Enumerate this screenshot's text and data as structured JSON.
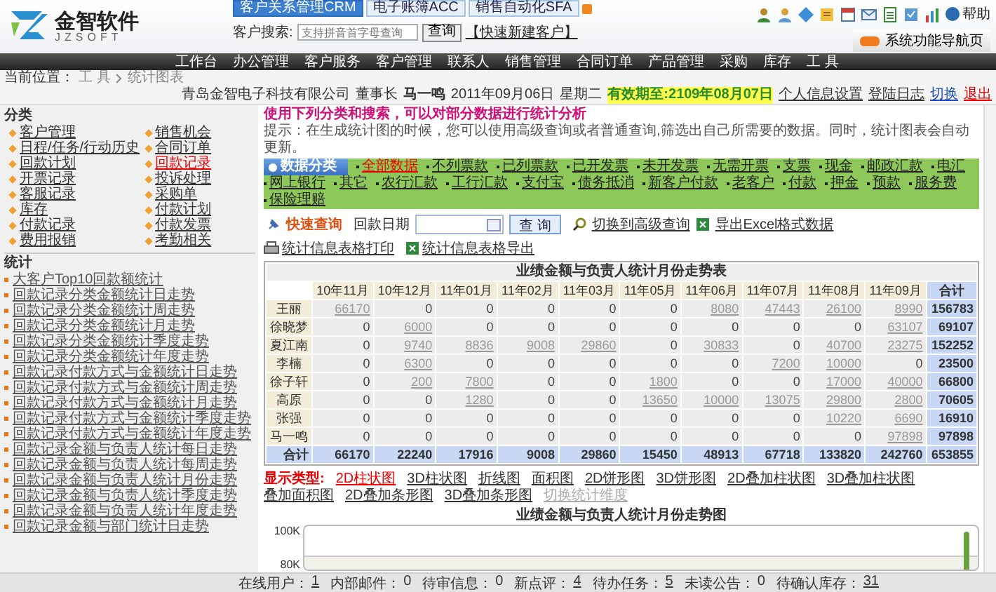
{
  "header": {
    "logo": {
      "name": "金智软件",
      "sub": "JZSOFT"
    },
    "product_tabs": [
      {
        "label": "客户关系管理CRM",
        "selected": true
      },
      {
        "label": "电子账簿ACC",
        "selected": false
      },
      {
        "label": "销售自动化SFA",
        "selected": false
      }
    ],
    "search": {
      "label": "客户搜索:",
      "placeholder": "支持拼音首字母查询",
      "button": "查询",
      "quick_link": "【快速新建客户】"
    },
    "help": "帮助",
    "nav_page_button": "系统功能导航页"
  },
  "nav": [
    "工作台",
    "办公管理",
    "客户服务",
    "客户管理",
    "联系人",
    "销售管理",
    "合同订单",
    "产品管理",
    "采购",
    "库存",
    "工 具"
  ],
  "info_bar": {
    "location_label": "当前位置：",
    "breadcrumb": [
      "工 具",
      "统计图表"
    ],
    "company": "青岛金智电子科技有限公司",
    "role": "董事长",
    "user": "马一鸣",
    "date": "2011年09月06日",
    "weekday": "星期二",
    "validity": "有效期至:2109年08月07日",
    "links": [
      {
        "label": "个人信息设置",
        "kind": "plain"
      },
      {
        "label": "登陆日志",
        "kind": "plain"
      },
      {
        "label": "切换",
        "kind": "switch"
      },
      {
        "label": "退出",
        "kind": "exit"
      }
    ]
  },
  "sidebar": {
    "category_title": "分类",
    "categories": [
      {
        "label": "客户管理",
        "selected": false
      },
      {
        "label": "销售机会",
        "selected": false
      },
      {
        "label": "日程/任务/行动历史",
        "selected": false
      },
      {
        "label": "合同订单",
        "selected": false
      },
      {
        "label": "回款计划",
        "selected": false
      },
      {
        "label": "回款记录",
        "selected": true
      },
      {
        "label": "开票记录",
        "selected": false
      },
      {
        "label": "投诉处理",
        "selected": false
      },
      {
        "label": "客服记录",
        "selected": false
      },
      {
        "label": "采购单",
        "selected": false
      },
      {
        "label": "库存",
        "selected": false
      },
      {
        "label": "付款计划",
        "selected": false
      },
      {
        "label": "付款记录",
        "selected": false
      },
      {
        "label": "付款发票",
        "selected": false
      },
      {
        "label": "费用报销",
        "selected": false
      },
      {
        "label": "考勤相关",
        "selected": false
      }
    ],
    "stats_title": "统计",
    "stats": [
      "大客户Top10回款额统计",
      "回款记录分类金额统计日走势",
      "回款记录分类金额统计周走势",
      "回款记录分类金额统计月走势",
      "回款记录分类金额统计季度走势",
      "回款记录分类金额统计年度走势",
      "回款记录付款方式与金额统计日走势",
      "回款记录付款方式与金额统计周走势",
      "回款记录付款方式与金额统计月走势",
      "回款记录付款方式与金额统计季度走势",
      "回款记录付款方式与金额统计年度走势",
      "回款记录金额与负责人统计每日走势",
      "回款记录金额与负责人统计每周走势",
      "回款记录金额与负责人统计月份走势",
      "回款记录金额与负责人统计季度走势",
      "回款记录金额与负责人统计年度走势",
      "回款记录金额与部门统计日走势"
    ]
  },
  "main": {
    "heading": "使用下列分类和搜索，可以对部分数据进行统计分析",
    "tip": "提示：在生成统计图的时候，您可以使用高级查询或者普通查询,筛选出自己所需要的数据。同时，统计图表会自动更新。",
    "category_bar": {
      "title": "数据分类",
      "items": [
        {
          "label": "全部数据",
          "selected": true
        },
        {
          "label": "不列票款",
          "selected": false
        },
        {
          "label": "已列票款",
          "selected": false
        },
        {
          "label": "已开发票",
          "selected": false
        },
        {
          "label": "未开发票",
          "selected": false
        },
        {
          "label": "无需开票",
          "selected": false
        },
        {
          "label": "支票",
          "selected": false
        },
        {
          "label": "现金",
          "selected": false
        },
        {
          "label": "邮政汇款",
          "selected": false
        },
        {
          "label": "电汇",
          "selected": false
        },
        {
          "label": "网上银行",
          "selected": false
        },
        {
          "label": "其它",
          "selected": false
        },
        {
          "label": "农行汇款",
          "selected": false
        },
        {
          "label": "工行汇款",
          "selected": false
        },
        {
          "label": "支付宝",
          "selected": false
        },
        {
          "label": "债务抵消",
          "selected": false
        },
        {
          "label": "新客户付款",
          "selected": false
        },
        {
          "label": "老客户",
          "selected": false
        },
        {
          "label": "付款",
          "selected": false
        },
        {
          "label": "押金",
          "selected": false
        },
        {
          "label": "预款",
          "selected": false
        },
        {
          "label": "服务费",
          "selected": false
        },
        {
          "label": "保险理赔",
          "selected": false
        }
      ]
    },
    "quick_search": {
      "title": "快速查询",
      "field_label": "回款日期",
      "button": "查 询",
      "advanced_link": "切换到高级查询",
      "export_link": "导出Excel格式数据"
    },
    "table_actions": [
      {
        "label": "统计信息表格打印",
        "kind": "print"
      },
      {
        "label": "统计信息表格导出",
        "kind": "export"
      }
    ],
    "table": {
      "title": "业绩金额与负责人统计月份走势表",
      "columns": [
        "10年11月",
        "10年12月",
        "11年01月",
        "11年02月",
        "11年03月",
        "11年05月",
        "11年06月",
        "11年07月",
        "11年08月",
        "11年09月"
      ],
      "total_header": "合计",
      "rows": [
        {
          "name": "王丽",
          "total": "156783",
          "cells": [
            {
              "v": "66170",
              "link": true
            },
            {
              "v": "0",
              "link": false
            },
            {
              "v": "0",
              "link": false
            },
            {
              "v": "0",
              "link": false
            },
            {
              "v": "0",
              "link": false
            },
            {
              "v": "0",
              "link": false
            },
            {
              "v": "8080",
              "link": true
            },
            {
              "v": "47443",
              "link": true
            },
            {
              "v": "26100",
              "link": true
            },
            {
              "v": "8990",
              "link": true
            }
          ]
        },
        {
          "name": "徐晓梦",
          "total": "69107",
          "cells": [
            {
              "v": "0",
              "link": false
            },
            {
              "v": "6000",
              "link": true
            },
            {
              "v": "0",
              "link": false
            },
            {
              "v": "0",
              "link": false
            },
            {
              "v": "0",
              "link": false
            },
            {
              "v": "0",
              "link": false
            },
            {
              "v": "0",
              "link": false
            },
            {
              "v": "0",
              "link": false
            },
            {
              "v": "0",
              "link": false
            },
            {
              "v": "63107",
              "link": true
            }
          ]
        },
        {
          "name": "夏江南",
          "total": "152252",
          "cells": [
            {
              "v": "0",
              "link": false
            },
            {
              "v": "9740",
              "link": true
            },
            {
              "v": "8836",
              "link": true
            },
            {
              "v": "9008",
              "link": true
            },
            {
              "v": "29860",
              "link": true
            },
            {
              "v": "0",
              "link": false
            },
            {
              "v": "30833",
              "link": true
            },
            {
              "v": "0",
              "link": false
            },
            {
              "v": "40700",
              "link": true
            },
            {
              "v": "23275",
              "link": true
            }
          ]
        },
        {
          "name": "李楠",
          "total": "23500",
          "cells": [
            {
              "v": "0",
              "link": false
            },
            {
              "v": "6300",
              "link": true
            },
            {
              "v": "0",
              "link": false
            },
            {
              "v": "0",
              "link": false
            },
            {
              "v": "0",
              "link": false
            },
            {
              "v": "0",
              "link": false
            },
            {
              "v": "0",
              "link": false
            },
            {
              "v": "7200",
              "link": true
            },
            {
              "v": "10000",
              "link": true
            },
            {
              "v": "0",
              "link": false
            }
          ]
        },
        {
          "name": "徐子轩",
          "total": "66800",
          "cells": [
            {
              "v": "0",
              "link": false
            },
            {
              "v": "200",
              "link": true
            },
            {
              "v": "7800",
              "link": true
            },
            {
              "v": "0",
              "link": false
            },
            {
              "v": "0",
              "link": false
            },
            {
              "v": "1800",
              "link": true
            },
            {
              "v": "0",
              "link": false
            },
            {
              "v": "0",
              "link": false
            },
            {
              "v": "17000",
              "link": true
            },
            {
              "v": "40000",
              "link": true
            }
          ]
        },
        {
          "name": "高原",
          "total": "70605",
          "cells": [
            {
              "v": "0",
              "link": false
            },
            {
              "v": "0",
              "link": false
            },
            {
              "v": "1280",
              "link": true
            },
            {
              "v": "0",
              "link": false
            },
            {
              "v": "0",
              "link": false
            },
            {
              "v": "13650",
              "link": true
            },
            {
              "v": "10000",
              "link": true
            },
            {
              "v": "13075",
              "link": true
            },
            {
              "v": "29800",
              "link": true
            },
            {
              "v": "2800",
              "link": true
            }
          ]
        },
        {
          "name": "张强",
          "total": "16910",
          "cells": [
            {
              "v": "0",
              "link": false
            },
            {
              "v": "0",
              "link": false
            },
            {
              "v": "0",
              "link": false
            },
            {
              "v": "0",
              "link": false
            },
            {
              "v": "0",
              "link": false
            },
            {
              "v": "0",
              "link": false
            },
            {
              "v": "0",
              "link": false
            },
            {
              "v": "0",
              "link": false
            },
            {
              "v": "10220",
              "link": true
            },
            {
              "v": "6690",
              "link": true
            }
          ]
        },
        {
          "name": "马一鸣",
          "total": "97898",
          "cells": [
            {
              "v": "0",
              "link": false
            },
            {
              "v": "0",
              "link": false
            },
            {
              "v": "0",
              "link": false
            },
            {
              "v": "0",
              "link": false
            },
            {
              "v": "0",
              "link": false
            },
            {
              "v": "0",
              "link": false
            },
            {
              "v": "0",
              "link": false
            },
            {
              "v": "0",
              "link": false
            },
            {
              "v": "0",
              "link": false
            },
            {
              "v": "97898",
              "link": true
            }
          ]
        }
      ],
      "totals": {
        "name": "合计",
        "total": "653855",
        "cells": [
          "66170",
          "22240",
          "17916",
          "9008",
          "29860",
          "15450",
          "48913",
          "67718",
          "133820",
          "242760"
        ]
      }
    },
    "chart_types": {
      "label": "显示类型:",
      "items": [
        {
          "label": "2D柱状图",
          "selected": true,
          "disabled": false
        },
        {
          "label": "3D柱状图",
          "selected": false,
          "disabled": false
        },
        {
          "label": "折线图",
          "selected": false,
          "disabled": false
        },
        {
          "label": "面积图",
          "selected": false,
          "disabled": false
        },
        {
          "label": "2D饼形图",
          "selected": false,
          "disabled": false
        },
        {
          "label": "3D饼形图",
          "selected": false,
          "disabled": false
        },
        {
          "label": "2D叠加柱状图",
          "selected": false,
          "disabled": false
        },
        {
          "label": "3D叠加柱状图",
          "selected": false,
          "disabled": false
        },
        {
          "label": "叠加面积图",
          "selected": false,
          "disabled": false
        },
        {
          "label": "2D叠加条形图",
          "selected": false,
          "disabled": false
        },
        {
          "label": "3D叠加条形图",
          "selected": false,
          "disabled": false
        },
        {
          "label": "切换统计维度",
          "selected": false,
          "disabled": true
        }
      ]
    },
    "chart": {
      "title": "业绩金额与负责人统计月份走势图",
      "y_labels": [
        "100K",
        "80K"
      ]
    }
  },
  "status_bar": [
    {
      "label": "在线用户：",
      "value": "1",
      "link": true
    },
    {
      "label": "内部邮件：",
      "value": "0",
      "link": false
    },
    {
      "label": "待审信息：",
      "value": "0",
      "link": false
    },
    {
      "label": "新点评：",
      "value": "4",
      "link": true
    },
    {
      "label": "待办任务：",
      "value": "5",
      "link": true
    },
    {
      "label": "未读公告：",
      "value": "0",
      "link": false
    },
    {
      "label": "待确认库存：",
      "value": "31",
      "link": true
    }
  ]
}
